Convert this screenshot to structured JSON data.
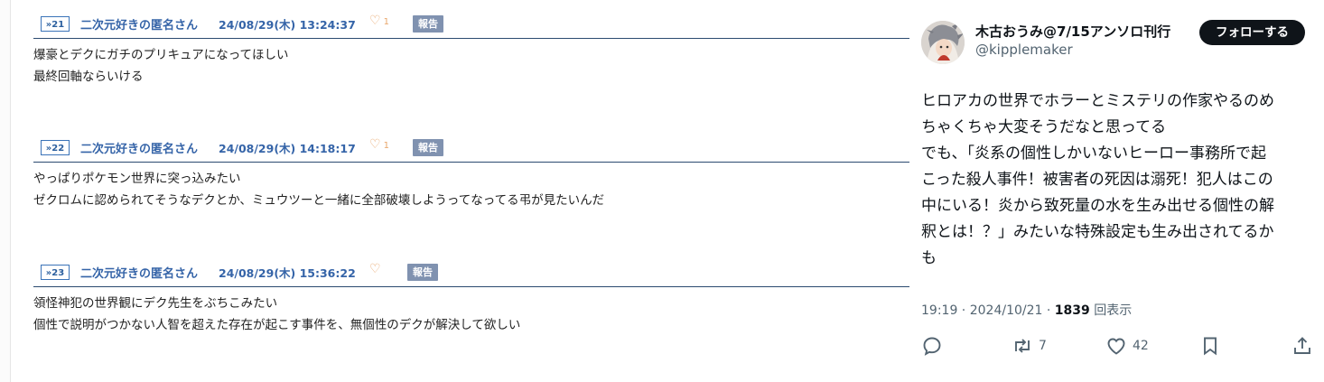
{
  "board": {
    "posts": [
      {
        "number": "21",
        "name": "二次元好きの匿名さん",
        "date": "24/08/29(木) 13:24:37",
        "likes": "1",
        "report_label": "報告",
        "lines": [
          "爆豪とデクにガチのプリキュアになってほしい",
          "最終回軸ならいける"
        ]
      },
      {
        "number": "22",
        "name": "二次元好きの匿名さん",
        "date": "24/08/29(木) 14:18:17",
        "likes": "1",
        "report_label": "報告",
        "lines": [
          "やっぱりポケモン世界に突っ込みたい",
          "ゼクロムに認められてそうなデクとか、ミュウツーと一緒に全部破壊しようってなってる弔が見たいんだ"
        ]
      },
      {
        "number": "23",
        "name": "二次元好きの匿名さん",
        "date": "24/08/29(木) 15:36:22",
        "likes": "",
        "report_label": "報告",
        "lines": [
          "領怪神犯の世界観にデク先生をぶちこみたい",
          "個性で説明がつかない人智を超えた存在が起こす事件を、無個性のデクが解決して欲しい"
        ]
      }
    ]
  },
  "tweet": {
    "author_name": "木古おうみ@7/15アンソロ刊行",
    "handle": "@kipplemaker",
    "follow_label": "フォローする",
    "lines": [
      "ヒロアカの世界でホラーとミステリの作家やるのめ",
      "ちゃくちゃ大変そうだなと思ってる",
      "でも、「炎系の個性しかいないヒーロー事務所で起",
      "こった殺人事件！被害者の死因は溺死！犯人はこの",
      "中にいる！炎から致死量の水を生み出せる個性の解",
      "釈とは！？」みたいな特殊設定も生み出されてるか",
      "も"
    ],
    "time": "19:19",
    "date": "2024/10/21",
    "views": "1839",
    "views_label": "回表示",
    "retweets": "7",
    "likes": "42",
    "icons": [
      "reply-icon",
      "retweet-icon",
      "like-icon",
      "bookmark-icon",
      "share-icon"
    ]
  },
  "colors": {
    "board_link": "#3564a8",
    "heart": "#e8a56a",
    "report_bg": "#8092b0",
    "follow_bg": "#0f1419",
    "muted": "#536471"
  }
}
